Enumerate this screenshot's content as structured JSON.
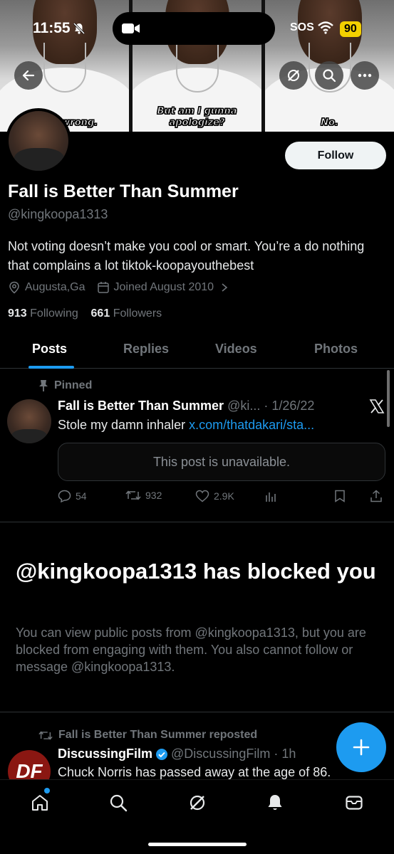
{
  "status_bar": {
    "time": "11:55",
    "sos": "SOS",
    "battery": "90"
  },
  "banner": {
    "captions": [
      "I was wrong.",
      "But am I gunna apologize?",
      "No."
    ]
  },
  "profile": {
    "display_name": "Fall is Better Than Summer",
    "handle": "@kingkoopa1313",
    "bio": "Not voting doesn’t make you cool or smart. You’re a do nothing that complains a lot tiktok-koopayouthebest",
    "location": "Augusta,Ga",
    "joined": "Joined August 2010",
    "following_count": "913",
    "following_label": "Following",
    "followers_count": "661",
    "followers_label": "Followers",
    "follow_label": "Follow"
  },
  "tabs": [
    "Posts",
    "Replies",
    "Videos",
    "Photos"
  ],
  "pinned_post": {
    "pinned_label": "Pinned",
    "author": "Fall is Better Than Summer",
    "meta": "@ki... · 1/26/22",
    "text": "Stole my damn inhaler ",
    "link": "x.com/thatdakari/sta...",
    "unavailable": "This post is unavailable.",
    "replies": "54",
    "reposts": "932",
    "likes": "2.9K"
  },
  "blocked": {
    "title": "@kingkoopa1313 has blocked you",
    "body": "You can view public posts from @kingkoopa1313, but you are blocked from engaging with them. You also cannot follow or message @kingkoopa1313."
  },
  "repost": {
    "label": "Fall is Better Than Summer reposted",
    "author": "DiscussingFilm",
    "meta": "@DiscussingFilm · 1h",
    "text": "Chuck Norris has passed away at the age of 86.",
    "avatar_text": "DF"
  },
  "colors": {
    "accent": "#1d9bf0",
    "battery": "#f2d000"
  },
  "icons": {
    "nav": [
      "home-icon",
      "search-icon",
      "grok-icon",
      "bell-icon",
      "mail-icon"
    ]
  }
}
